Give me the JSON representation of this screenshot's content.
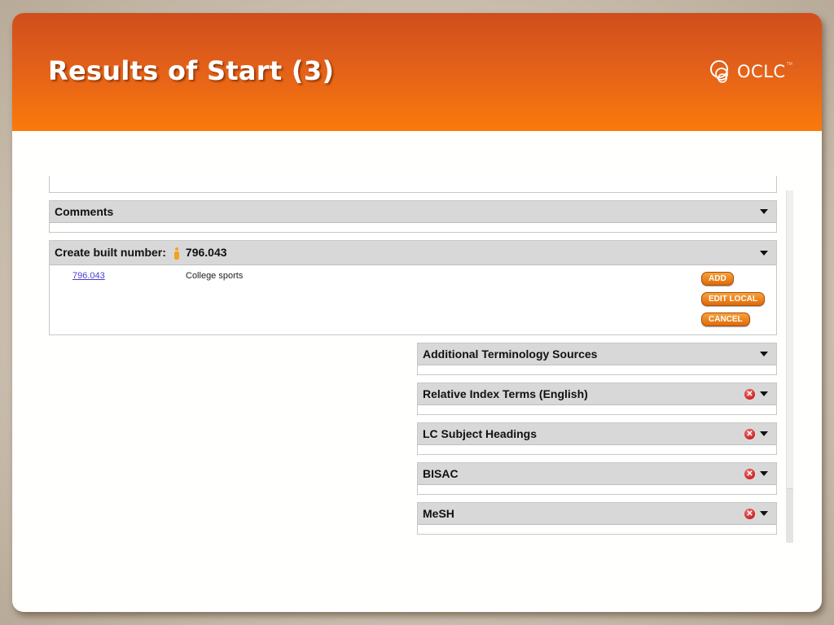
{
  "slide": {
    "title": "Results of Start (3)",
    "logo": {
      "icon": "oclc-logo-icon",
      "text": "OCLC",
      "tm": "TM"
    }
  },
  "panels": {
    "comments": {
      "label": "Comments"
    },
    "built_number": {
      "label": "Create built number:",
      "value": "796.043",
      "row": {
        "number": "796.043",
        "description": "College sports"
      },
      "buttons": {
        "add": "ADD",
        "edit_local": "EDIT LOCAL",
        "cancel": "CANCEL"
      }
    },
    "additional_sources": {
      "label": "Additional Terminology Sources"
    },
    "relative_index": {
      "label": "Relative Index Terms (English)"
    },
    "lcsh": {
      "label": "LC Subject Headings"
    },
    "bisac": {
      "label": "BISAC"
    },
    "mesh": {
      "label": "MeSH"
    }
  },
  "icons": {
    "close": "✕"
  },
  "colors": {
    "header_top": "#cf4e1c",
    "header_bottom": "#fb7a0a",
    "button": "#e06a0a",
    "link": "#4a3fd0"
  }
}
